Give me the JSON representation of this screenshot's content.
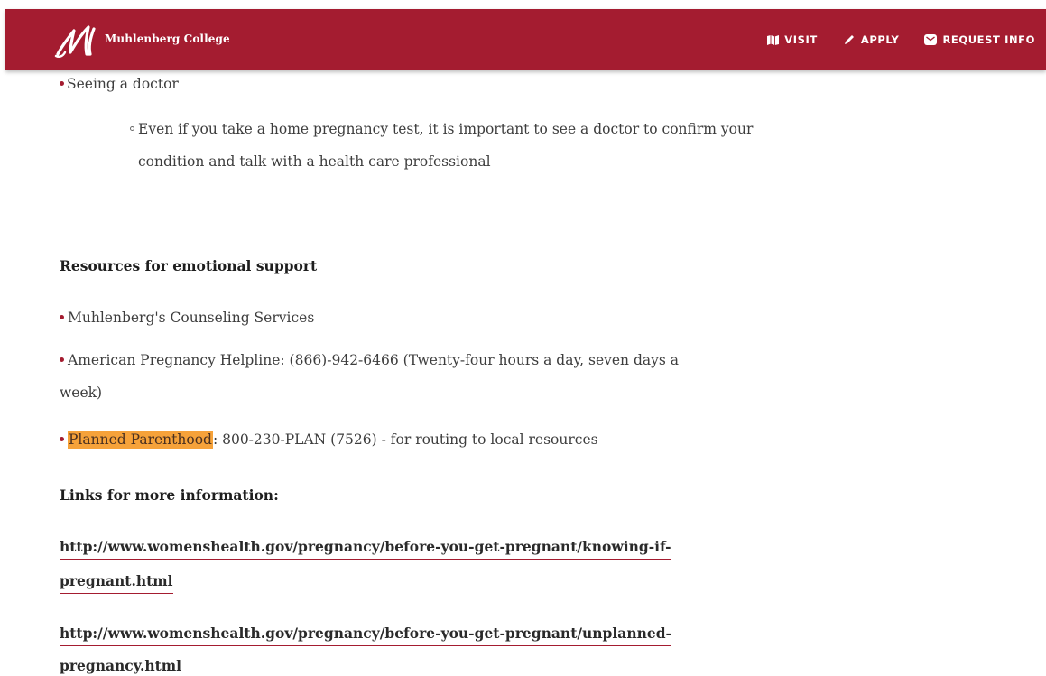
{
  "header": {
    "brand": "Muhlenberg College",
    "nav": [
      {
        "label": "VISIT",
        "icon": "map-icon"
      },
      {
        "label": "APPLY",
        "icon": "pencil-icon"
      },
      {
        "label": "REQUEST INFO",
        "icon": "envelope-icon"
      }
    ],
    "bar_color": "#a41c30"
  },
  "content": {
    "seeing_doctor": "Seeing a doctor",
    "doctor_detail_line1": "Even if you take a home pregnancy test, it is important to see a doctor to confirm your",
    "doctor_detail_line2": "condition and talk with a health care professional",
    "emotional_heading": "Resources for emotional support",
    "resources": {
      "counseling": "Muhlenberg's Counseling Services",
      "helpline_line1": "American Pregnancy Helpline:  (866)-942-6466 (Twenty-four hours a day, seven days a",
      "helpline_line2": "week)",
      "planned_parenthood_link": "Planned Parenthood",
      "planned_parenthood_rest": ": 800-230-PLAN (7526) - for routing to local resources"
    },
    "links_heading": "Links for more information:",
    "links": [
      {
        "line1": "http://www.womenshealth.gov/pregnancy/before-you-get-pregnant/knowing-if-",
        "line2": "pregnant.html"
      },
      {
        "line1": "http://www.womenshealth.gov/pregnancy/before-you-get-pregnant/unplanned-",
        "line2": "pregnancy.html"
      }
    ],
    "highlight_color": "#f6a23a"
  }
}
